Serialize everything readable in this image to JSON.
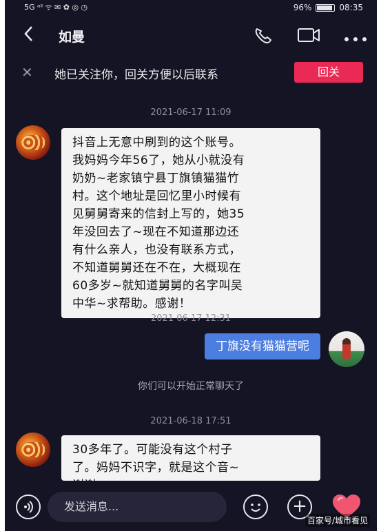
{
  "status_bar": {
    "left_indicators": "5G ᵃˡˡ ᯤ ✉ ✿ ◎ ◷",
    "battery_percent": "96%",
    "battery_level": 0.96,
    "time": "08:35"
  },
  "header": {
    "title": "如曼",
    "icons": [
      "back-icon",
      "phone-icon",
      "video-icon",
      "more-icon"
    ]
  },
  "banner": {
    "text": "她已关注你，回关方便以后联系",
    "follow_button": "回关"
  },
  "messages": [
    {
      "timestamp": "2021-06-17 11:09",
      "from": "other",
      "lines": [
        "抖音上无意中刷到的这个账号。",
        "我妈妈今年56了，她从小就没有",
        "奶奶~老家镇宁县丁旗镇猫猫竹",
        "村。这个地址是回忆里小时候有",
        "见舅舅寄来的信封上写的，她35",
        "年没回去了~现在不知道那边还",
        "有什么亲人，也没有联系方式，",
        "不知道舅舅还在不在，大概现在",
        "60多岁~就知道舅舅的名字叫吴",
        "中华~求帮助。感谢！"
      ]
    },
    {
      "timestamp": "2021 06 17 12:31",
      "from": "self",
      "text": "丁旗没有猫猫营呢"
    },
    {
      "system": "你们可以开始正常聊天了"
    },
    {
      "timestamp": "2021-06-18 17:51",
      "from": "other",
      "lines": [
        "30多年了。可能没有这个村子",
        "了。妈妈不识字，就是这个音~",
        "谢谢"
      ]
    }
  ],
  "input_bar": {
    "placeholder": "发送消息..."
  },
  "watermark": "百家号/城市看见",
  "colors": {
    "background": "#151424",
    "accent_red": "#ea2a55",
    "bubble_out": "#4c7de0",
    "bubble_in": "#f4f3f3"
  }
}
